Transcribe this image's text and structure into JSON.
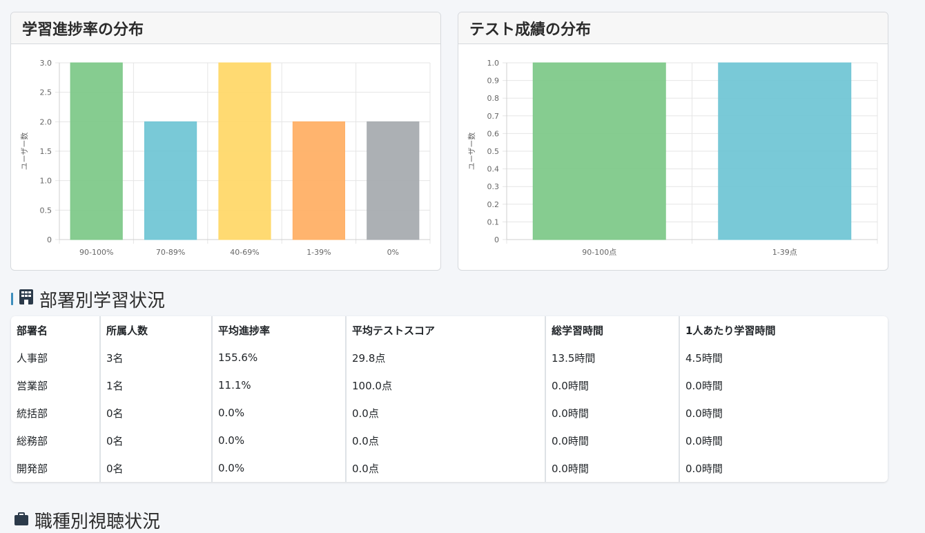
{
  "chart_data": [
    {
      "type": "bar",
      "title": "学習進捗率の分布",
      "categories": [
        "90-100%",
        "70-89%",
        "40-69%",
        "1-39%",
        "0%"
      ],
      "values": [
        3,
        2,
        3,
        2,
        2
      ],
      "colors": [
        "#7fc98a",
        "#72c6d5",
        "#ffd86a",
        "#ffb066",
        "#a8acb0"
      ],
      "ylabel": "ユーザー数",
      "ylim": [
        0,
        3
      ],
      "yticks": [
        "0",
        "0.5",
        "1.0",
        "1.5",
        "2.0",
        "2.5",
        "3.0"
      ],
      "grid": true
    },
    {
      "type": "bar",
      "title": "テスト成績の分布",
      "categories": [
        "90-100点",
        "1-39点"
      ],
      "values": [
        1,
        1
      ],
      "colors": [
        "#7fc98a",
        "#72c6d5"
      ],
      "ylabel": "ユーザー数",
      "ylim": [
        0,
        1
      ],
      "yticks": [
        "0",
        "0.1",
        "0.2",
        "0.3",
        "0.4",
        "0.5",
        "0.6",
        "0.7",
        "0.8",
        "0.9",
        "1.0"
      ],
      "grid": true
    }
  ],
  "section": {
    "title": "部署別学習状況",
    "icon": "building-icon"
  },
  "table": {
    "headers": [
      "部署名",
      "所属人数",
      "平均進捗率",
      "平均テストスコア",
      "総学習時間",
      "1人あたり学習時間"
    ],
    "rows": [
      [
        "人事部",
        "3名",
        "155.6%",
        "29.8点",
        "13.5時間",
        "4.5時間"
      ],
      [
        "営業部",
        "1名",
        "11.1%",
        "100.0点",
        "0.0時間",
        "0.0時間"
      ],
      [
        "統括部",
        "0名",
        "0.0%",
        "0.0点",
        "0.0時間",
        "0.0時間"
      ],
      [
        "総務部",
        "0名",
        "0.0%",
        "0.0点",
        "0.0時間",
        "0.0時間"
      ],
      [
        "開発部",
        "0名",
        "0.0%",
        "0.0点",
        "0.0時間",
        "0.0時間"
      ]
    ]
  },
  "next_section": {
    "title": "職種別視聴状況",
    "icon": "briefcase-icon"
  }
}
